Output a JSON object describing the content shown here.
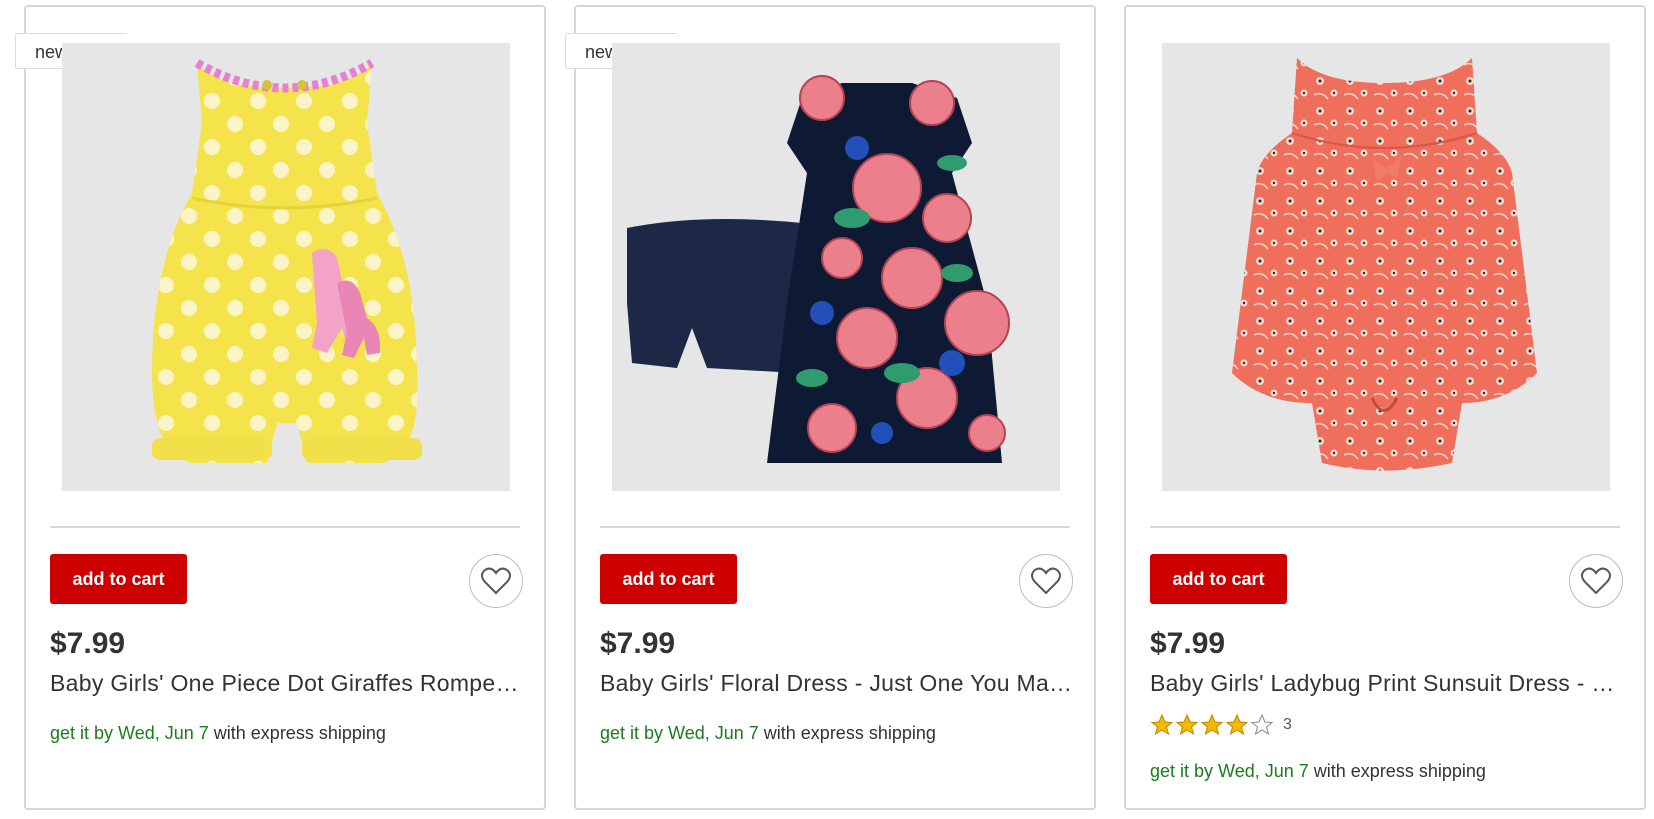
{
  "products": [
    {
      "badge": "new at",
      "add_to_cart": "add to cart",
      "price": "$7.99",
      "title": "Baby Girls' One Piece Dot Giraffes Romper - Just One You",
      "shipping_date": "get it by Wed, Jun 7",
      "shipping_method": "with express shipping",
      "image_icon": "yellow-polka-dot-romper-image"
    },
    {
      "badge": "new at",
      "add_to_cart": "add to cart",
      "price": "$7.99",
      "title": "Baby Girls' Floral Dress - Just One You Made by Carter's",
      "shipping_date": "get it by Wed, Jun 7",
      "shipping_method": "with express shipping",
      "image_icon": "floral-dress-set-image"
    },
    {
      "add_to_cart": "add to cart",
      "price": "$7.99",
      "title": "Baby Girls' Ladybug Print Sunsuit Dress - Just One You",
      "rating": {
        "stars": 4,
        "max": 5,
        "count": "3"
      },
      "shipping_date": "get it by Wed, Jun 7",
      "shipping_method": "with express shipping",
      "image_icon": "coral-sunsuit-image"
    }
  ],
  "colors": {
    "brand_red": "#cc0000",
    "shipping_green": "#1c7b1c",
    "star_gold": "#f5b800",
    "image_bg": "#e6e6e6"
  }
}
